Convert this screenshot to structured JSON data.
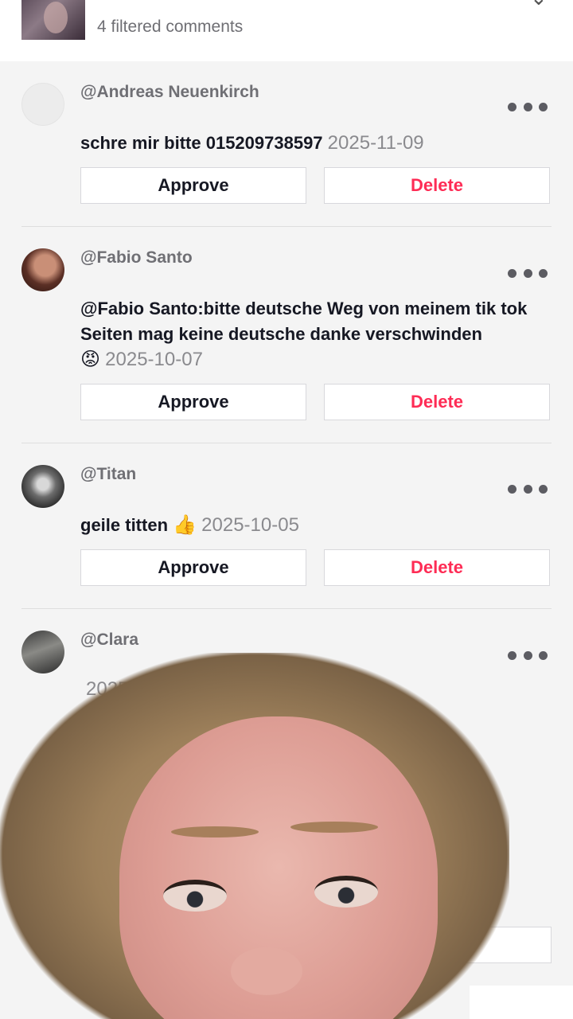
{
  "header": {
    "filtered_count": "4 filtered comments"
  },
  "comments": [
    {
      "username": "@Andreas Neuenkirch",
      "text": "schre mir bitte 015209738597",
      "date": "2025-11-09",
      "approve_label": "Approve",
      "delete_label": "Delete"
    },
    {
      "username": "@Fabio Santo",
      "text": "@Fabio Santo:bitte deutsche Weg von meinem tik tok Seiten mag keine deutsche danke verschwinden",
      "emoji": "😡",
      "date": "2025-10-07",
      "approve_label": "Approve",
      "delete_label": "Delete"
    },
    {
      "username": "@Titan",
      "text": "geile titten",
      "emoji": "👍",
      "date": "2025-10-05",
      "approve_label": "Approve",
      "delete_label": "Delete"
    },
    {
      "username": "@Clara",
      "date_partial": "2025-1"
    }
  ],
  "icons": {
    "more": "more-horizontal-icon",
    "close": "close-icon"
  },
  "colors": {
    "delete": "#fe2c55",
    "background": "#f4f4f4"
  }
}
